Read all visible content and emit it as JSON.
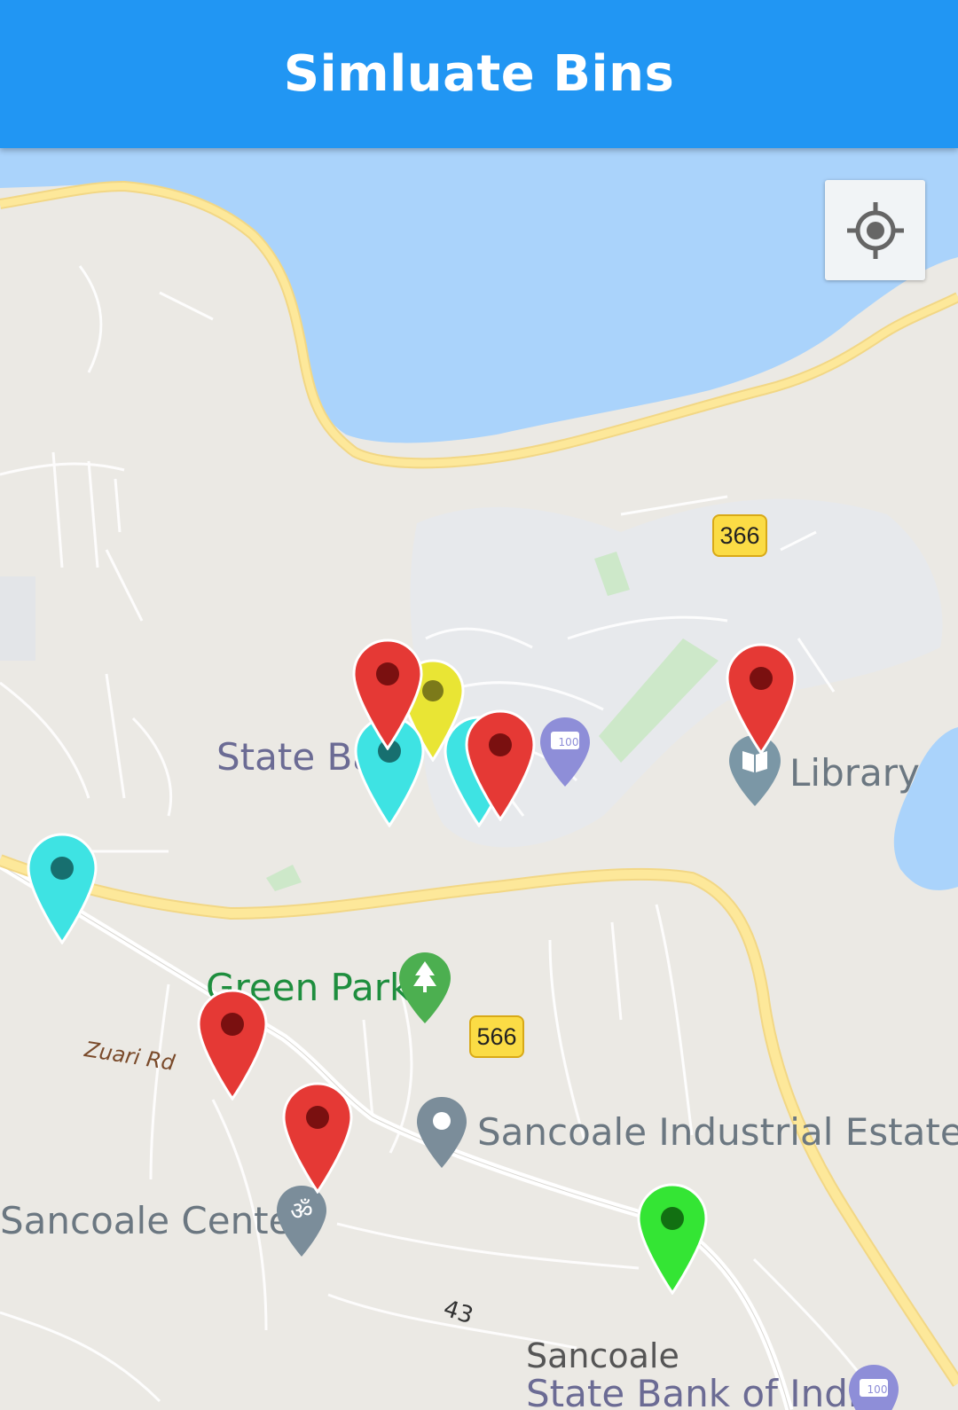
{
  "appbar": {
    "title": "Simluate Bins"
  },
  "map": {
    "labels": {
      "state_bank_top": "State Ba",
      "library": "Library",
      "green_park": "Green Park",
      "zuari_rd": "Zuari Rd",
      "sancoale_industrial": "Sancoale Industrial Estate",
      "sancoale_center": "Sancoale Center",
      "sancoale": "Sancoale",
      "state_bank_bottom": "State Bank of India",
      "road_43": "43"
    },
    "shields": {
      "r366": "366",
      "r566": "566"
    },
    "poi_badges": {
      "bank_top": "100",
      "bank_bottom": "100"
    },
    "icons": {
      "my_location": "my-location-icon",
      "bank": "bank-icon",
      "library": "library-icon",
      "park": "park-icon",
      "pin": "pin-icon",
      "temple": "temple-icon"
    },
    "colors": {
      "water": "#aad3fb",
      "land": "#ebe9e4",
      "road_major": "#fde293",
      "appbar": "#2196f3",
      "bin_red": "#e53935",
      "bin_cyan": "#3ee3e3",
      "bin_yellow": "#e9e534",
      "bin_green": "#34e534"
    },
    "bins": [
      {
        "id": "bin-1",
        "status": "red"
      },
      {
        "id": "bin-2",
        "status": "yellow"
      },
      {
        "id": "bin-3",
        "status": "cyan"
      },
      {
        "id": "bin-4",
        "status": "cyan"
      },
      {
        "id": "bin-5",
        "status": "red"
      },
      {
        "id": "bin-6",
        "status": "red"
      },
      {
        "id": "bin-7",
        "status": "cyan"
      },
      {
        "id": "bin-8",
        "status": "red"
      },
      {
        "id": "bin-9",
        "status": "red"
      },
      {
        "id": "bin-10",
        "status": "green"
      }
    ]
  }
}
